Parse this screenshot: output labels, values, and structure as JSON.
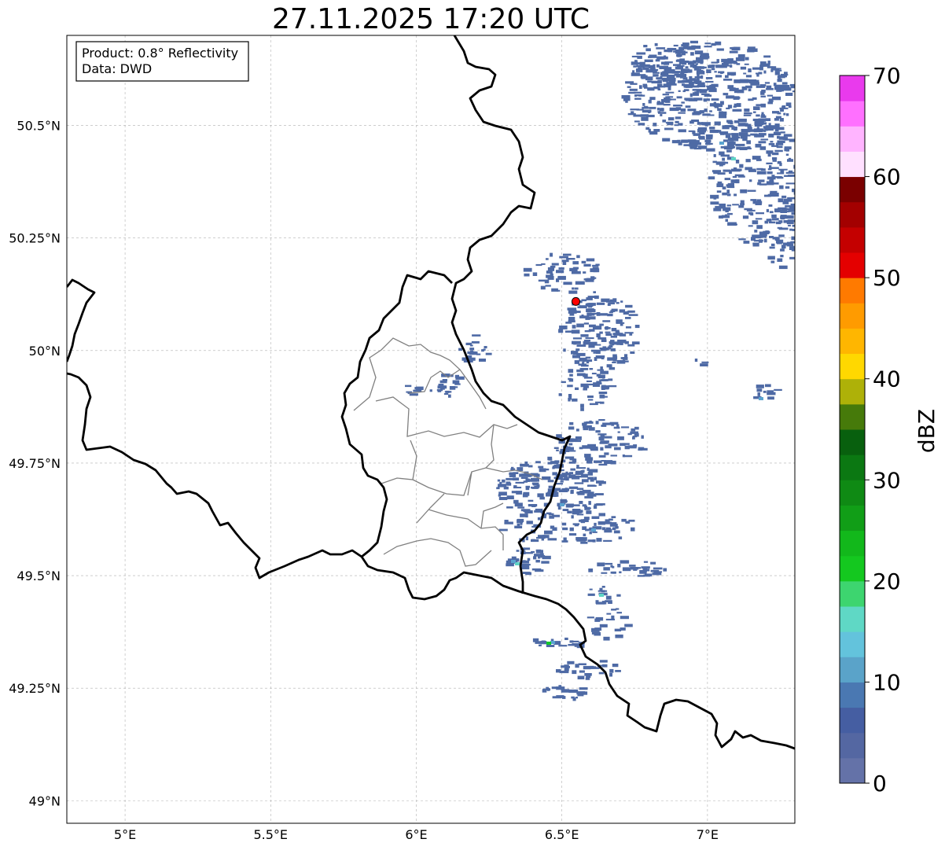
{
  "map": {
    "title": "27.11.2025 17:20 UTC",
    "info": {
      "line1": "Product: 0.8° Reflectivity",
      "line2": "Data: DWD"
    },
    "lon_range": [
      4.8,
      7.3
    ],
    "lat_range": [
      48.95,
      50.7
    ],
    "lon_ticks": [
      {
        "value": 5.0,
        "label": "5°E"
      },
      {
        "value": 5.5,
        "label": "5.5°E"
      },
      {
        "value": 6.0,
        "label": "6°E"
      },
      {
        "value": 6.5,
        "label": "6.5°E"
      },
      {
        "value": 7.0,
        "label": "7°E"
      }
    ],
    "lat_ticks": [
      {
        "value": 49.0,
        "label": "49°N"
      },
      {
        "value": 49.25,
        "label": "49.25°N"
      },
      {
        "value": 49.5,
        "label": "49.5°N"
      },
      {
        "value": 49.75,
        "label": "49.75°N"
      },
      {
        "value": 50.0,
        "label": "50°N"
      },
      {
        "value": 50.25,
        "label": "50.25°N"
      },
      {
        "value": 50.5,
        "label": "50.5°N"
      }
    ],
    "radar_site": {
      "lon": 6.548,
      "lat": 50.109,
      "color": "#ff0000"
    },
    "echo_color": "#4e6aa5",
    "echo_color_light": "#5aa3d0",
    "echo_color_cyan": "#5fd5c5",
    "echo_color_green": "#12c82a",
    "border_color": "#000000",
    "admin_color": "#808080"
  },
  "colorbar": {
    "label": "dBZ",
    "min": 0,
    "max": 70,
    "step": 2.5,
    "ticks": [
      "0",
      "10",
      "20",
      "30",
      "40",
      "50",
      "60",
      "70"
    ],
    "colors": [
      "#6472a8",
      "#5467a2",
      "#455ea2",
      "#4a78b2",
      "#5aa3c9",
      "#63c3dc",
      "#5fd8c5",
      "#3dd56f",
      "#14c81f",
      "#12b81b",
      "#119e17",
      "#0f8a14",
      "#0b7812",
      "#08600e",
      "#467a0a",
      "#aeb108",
      "#ffd800",
      "#ffb600",
      "#ff9b00",
      "#ff7a00",
      "#e40000",
      "#c40000",
      "#a30000",
      "#7a0000",
      "#ffe0ff",
      "#ffb4ff",
      "#ff70ff",
      "#e93aed"
    ]
  }
}
